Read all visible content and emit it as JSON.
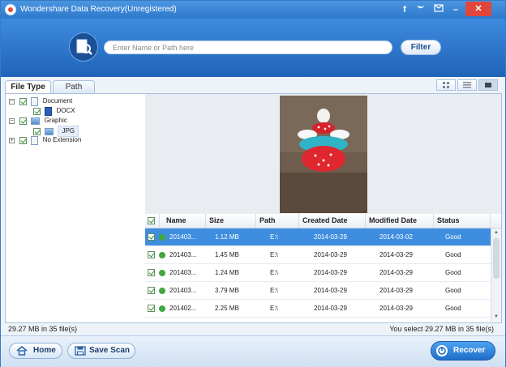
{
  "window": {
    "title": "Wondershare Data Recovery(Unregistered)"
  },
  "titlebar": {
    "buttons": [
      "facebook-icon",
      "twitter-icon",
      "feedback-icon",
      "minimize-icon",
      "close-icon"
    ]
  },
  "search": {
    "placeholder": "Enter Name or Path here",
    "value": "",
    "filter_label": "Filter"
  },
  "tabs": [
    {
      "label": "File Type",
      "active": true
    },
    {
      "label": "Path",
      "active": false
    }
  ],
  "view_modes": [
    "thumbnail-view-icon",
    "list-view-icon",
    "detail-view-icon"
  ],
  "tree": [
    {
      "label": "Document",
      "children": [
        {
          "label": "DOCX"
        }
      ]
    },
    {
      "label": "Graphic",
      "children": [
        {
          "label": "JPG",
          "selected": true
        }
      ]
    },
    {
      "label": "No Extension",
      "children": []
    }
  ],
  "table": {
    "headers": [
      "Name",
      "Size",
      "Path",
      "Created Date",
      "Modified Date",
      "Status"
    ],
    "rows": [
      {
        "name": "201403...",
        "size": "1.12 MB",
        "path": "E:\\",
        "created": "2014-03-29",
        "modified": "2014-03-02",
        "status": "Good",
        "selected": true
      },
      {
        "name": "201403...",
        "size": "1.45 MB",
        "path": "E:\\",
        "created": "2014-03-29",
        "modified": "2014-03-29",
        "status": "Good"
      },
      {
        "name": "201403...",
        "size": "1.24 MB",
        "path": "E:\\",
        "created": "2014-03-29",
        "modified": "2014-03-29",
        "status": "Good"
      },
      {
        "name": "201403...",
        "size": "3.79 MB",
        "path": "E:\\",
        "created": "2014-03-29",
        "modified": "2014-03-29",
        "status": "Good"
      },
      {
        "name": "201402...",
        "size": "2.25 MB",
        "path": "E:\\",
        "created": "2014-03-29",
        "modified": "2014-03-29",
        "status": "Good"
      }
    ]
  },
  "status": {
    "left": "29.27 MB in 35 file(s)",
    "right": "You select 29.27 MB in 35 file(s)"
  },
  "buttons": {
    "home": "Home",
    "save_scan": "Save Scan",
    "recover": "Recover"
  },
  "colors": {
    "accent": "#2f78cc",
    "selected_row": "#3f8ddf",
    "status_ok": "#3fa83f"
  }
}
